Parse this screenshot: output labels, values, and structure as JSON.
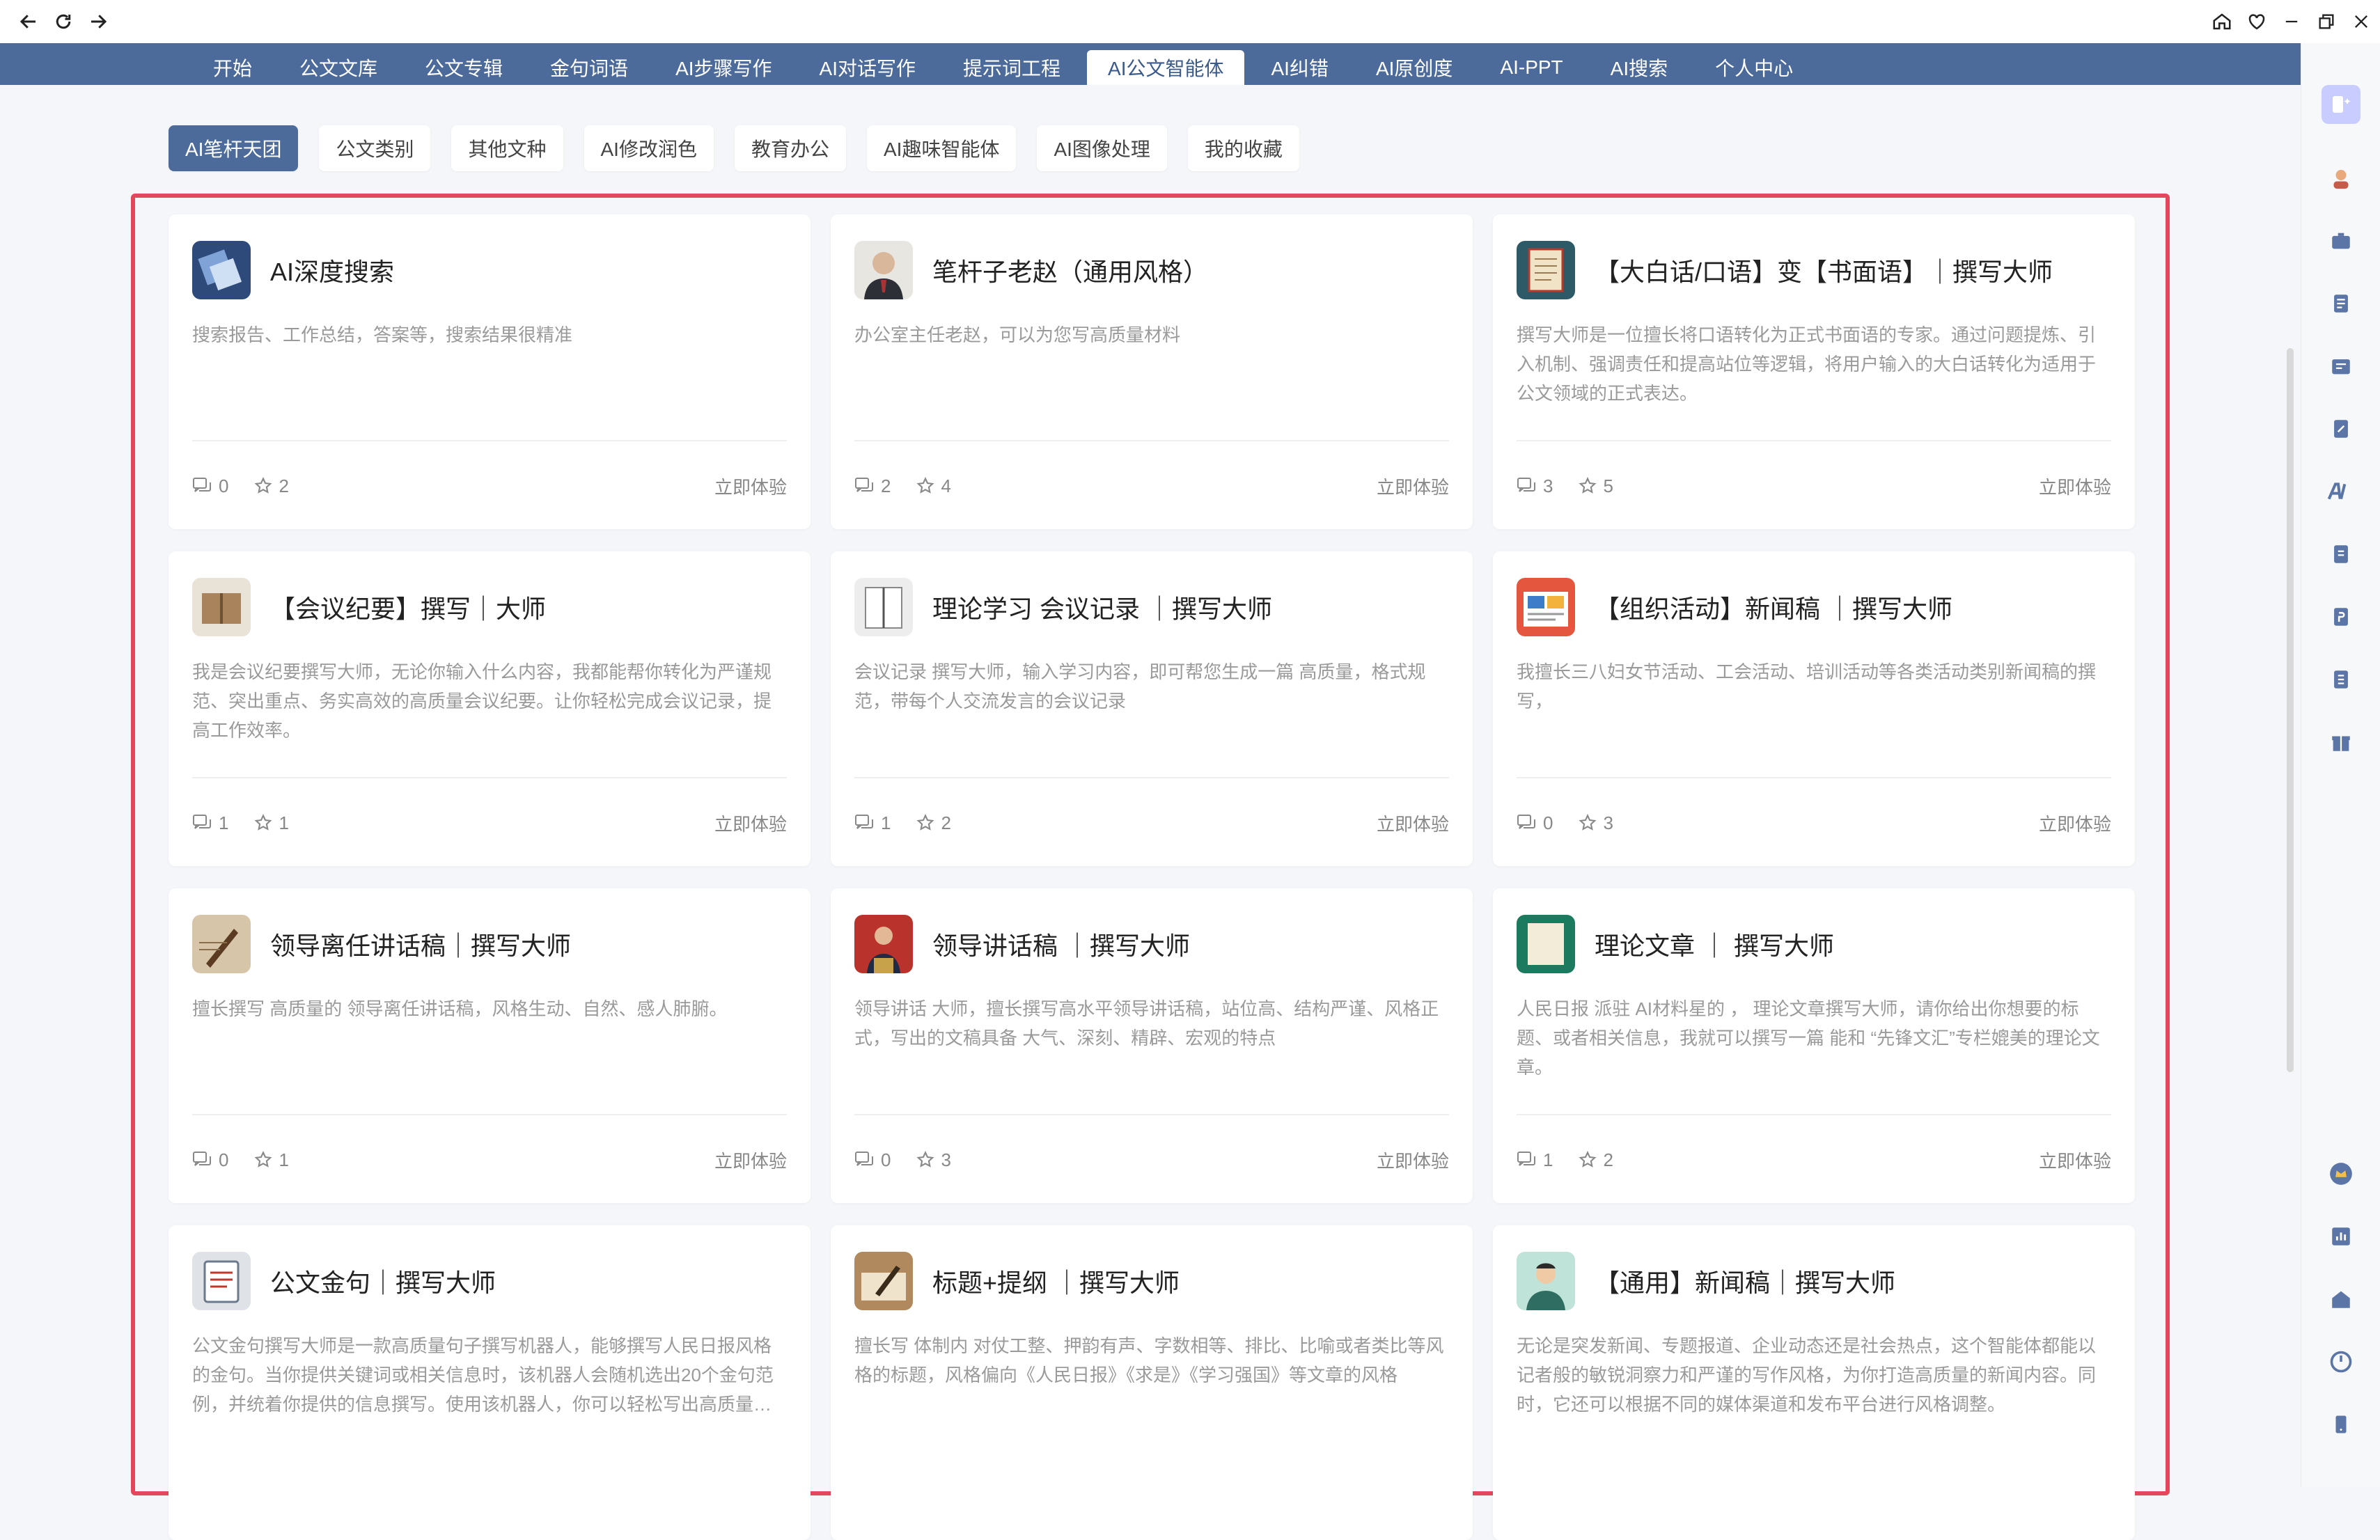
{
  "nav": {
    "items": [
      "开始",
      "公文文库",
      "公文专辑",
      "金句词语",
      "AI步骤写作",
      "AI对话写作",
      "提示词工程",
      "AI公文智能体",
      "AI纠错",
      "AI原创度",
      "AI-PPT",
      "AI搜索",
      "个人中心"
    ],
    "active_index": 7
  },
  "filters": {
    "items": [
      "AI笔杆天团",
      "公文类别",
      "其他文种",
      "AI修改润色",
      "教育办公",
      "AI趣味智能体",
      "AI图像处理",
      "我的收藏"
    ],
    "active_index": 0
  },
  "cards": [
    {
      "title": "AI深度搜索",
      "desc": "搜索报告、工作总结，答案等，搜索结果很精准",
      "comments": "0",
      "stars": "2",
      "action": "立即体验",
      "avatar_icon": "search-logo-icon"
    },
    {
      "title": "笔杆子老赵（通用风格）",
      "desc": "办公室主任老赵，可以为您写高质量材料",
      "comments": "2",
      "stars": "4",
      "action": "立即体验",
      "avatar_icon": "person-portrait-icon"
    },
    {
      "title": "【大白话/口语】变【书面语】｜撰写大师",
      "desc": "撰写大师是一位擅长将口语转化为正式书面语的专家。通过问题提炼、引入机制、强调责任和提高站位等逻辑，将用户输入的大白话转化为适用于公文领域的正式表达。",
      "comments": "3",
      "stars": "5",
      "action": "立即体验",
      "avatar_icon": "scroll-document-icon"
    },
    {
      "title": "【会议纪要】撰写｜大师",
      "desc": "我是会议纪要撰写大师，无论你输入什么内容，我都能帮你转化为严谨规范、突出重点、务实高效的高质量会议纪要。让你轻松完成会议记录，提高工作效率。",
      "comments": "1",
      "stars": "1",
      "action": "立即体验",
      "avatar_icon": "open-book-icon"
    },
    {
      "title": "理论学习 会议记录 ｜撰写大师",
      "desc": "会议记录 撰写大师，输入学习内容，即可帮您生成一篇 高质量，格式规范，带每个人交流发言的会议记录",
      "comments": "1",
      "stars": "2",
      "action": "立即体验",
      "avatar_icon": "notebook-icon"
    },
    {
      "title": "【组织活动】新闻稿 ｜撰写大师",
      "desc": "我擅长三八妇女节活动、工会活动、培训活动等各类活动类别新闻稿的撰写，",
      "comments": "0",
      "stars": "3",
      "action": "立即体验",
      "avatar_icon": "news-board-icon"
    },
    {
      "title": "领导离任讲话稿｜撰写大师",
      "desc": "擅长撰写 高质量的 领导离任讲话稿，风格生动、自然、感人肺腑。",
      "comments": "0",
      "stars": "1",
      "action": "立即体验",
      "avatar_icon": "pen-writing-icon"
    },
    {
      "title": "领导讲话稿 ｜撰写大师",
      "desc": "领导讲话 大师，擅长撰写高水平领导讲话稿，站位高、结构严谨、风格正式，写出的文稿具备 大气、深刻、精辟、宏观的特点",
      "comments": "0",
      "stars": "3",
      "action": "立即体验",
      "avatar_icon": "speaker-podium-icon"
    },
    {
      "title": "理论文章 ｜ 撰写大师",
      "desc": "人民日报 派驻 AI材料星的 ， 理论文章撰写大师，请你给出你想要的标题、或者相关信息，我就可以撰写一篇 能和 “先锋文汇”专栏媲美的理论文章。",
      "comments": "1",
      "stars": "2",
      "action": "立即体验",
      "avatar_icon": "green-paper-icon"
    },
    {
      "title": "公文金句｜撰写大师",
      "desc": "公文金句撰写大师是一款高质量句子撰写机器人，能够撰写人民日报风格的金句。当你提供关键词或相关信息时，该机器人会随机选出20个金句范例，并统着你提供的信息撰写。使用该机器人，你可以轻松写出高质量的金句。",
      "comments": "",
      "stars": "",
      "action": "",
      "avatar_icon": "clipboard-icon"
    },
    {
      "title": "标题+提纲 ｜撰写大师",
      "desc": "擅长写 体制内 对仗工整、押韵有声、字数相等、排比、比喻或者类比等风格的标题，风格偏向《人民日报》《求是》《学习强国》等文章的风格",
      "comments": "",
      "stars": "",
      "action": "",
      "avatar_icon": "hand-writing-icon"
    },
    {
      "title": "【通用】新闻稿｜撰写大师",
      "desc": "无论是突发新闻、专题报道、企业动态还是社会热点，这个智能体都能以记者般的敏锐洞察力和严谨的写作风格，为你打造高质量的新闻内容。同时，它还可以根据不同的媒体渠道和发布平台进行风格调整。",
      "comments": "",
      "stars": "",
      "action": "",
      "avatar_icon": "reporter-avatar-icon"
    }
  ],
  "colors": {
    "nav_bg": "#4c6a9a",
    "active_text": "#3a5a8c",
    "highlight_border": "#e4475c",
    "page_bg": "#f4f6f9"
  }
}
